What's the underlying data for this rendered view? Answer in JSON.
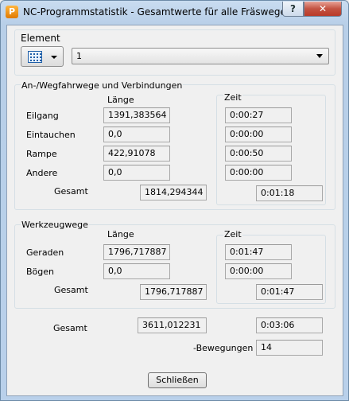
{
  "window": {
    "title": "NC-Programmstatistik - Gesamtwerte für alle Fräswege",
    "app_icon_letter": "P",
    "help_label": "?",
    "close_label": "✕"
  },
  "element": {
    "label": "Element",
    "icon": "toolpath-grid-icon",
    "selected": "1"
  },
  "approach": {
    "title": "An-/Wegfahrwege und Verbindungen",
    "length_header": "Länge",
    "time_header": "Zeit",
    "rows": [
      {
        "label": "Eilgang",
        "length": "1391,383564",
        "time": "0:00:27"
      },
      {
        "label": "Eintauchen",
        "length": "0,0",
        "time": "0:00:00"
      },
      {
        "label": "Rampe",
        "length": "422,91078",
        "time": "0:00:50"
      },
      {
        "label": "Andere",
        "length": "0,0",
        "time": "0:00:00"
      }
    ],
    "total_label": "Gesamt",
    "total_length": "1814,294344",
    "total_time": "0:01:18"
  },
  "tool": {
    "title": "Werkzeugwege",
    "length_header": "Länge",
    "time_header": "Zeit",
    "rows": [
      {
        "label": "Geraden",
        "length": "1796,717887",
        "time": "0:01:47"
      },
      {
        "label": "Bögen",
        "length": "0,0",
        "time": "0:00:00"
      }
    ],
    "total_label": "Gesamt",
    "total_length": "1796,717887",
    "total_time": "0:01:47"
  },
  "summary": {
    "total_label": "Gesamt",
    "total_length": "3611,012231",
    "total_time": "0:03:06",
    "moves_label": "-Bewegungen",
    "moves_value": "14"
  },
  "buttons": {
    "close": "Schließen"
  }
}
